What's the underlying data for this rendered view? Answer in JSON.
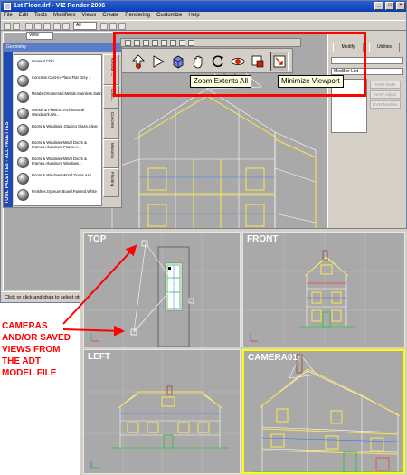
{
  "window": {
    "title": "1st Floor.drf - VIZ Render 2006",
    "controls": [
      "_",
      "□",
      "×"
    ]
  },
  "menu": [
    "File",
    "Edit",
    "Tools",
    "Modifiers",
    "Views",
    "Create",
    "Rendering",
    "Customize",
    "Help"
  ],
  "toolbar": {
    "selection_filter": "All",
    "reference_coord": "View"
  },
  "command_panel": {
    "tabs": [
      "Modify",
      "Utilities"
    ],
    "modifier_list": "Modifier List",
    "buttons": [
      "NVW Make",
      "NVW Adjust",
      "NVW Modifier"
    ]
  },
  "tool_palette": {
    "header": "Geometry",
    "strip_title": "TOOL PALETTES - ALL PALETTES",
    "items": [
      "General.Chip",
      "Concrete.Cast-In-Place.Flat Grey 1",
      "Metals.Ornamental Metals.Stainless.Satin",
      "Woods & Plastics .Architectural Woodwork.Wo...",
      "Doors & Windows .Glazing Glass.Clear",
      "Doors & Windows.Metal Doors & Frames.Aluminum Frame.A...",
      "Doors & Windows.Metal Doors & Frames.Aluminum Windows...",
      "Doors & Windows.Wood Doors.Ash",
      "Finishes.Gypsum Board.Painted.White"
    ],
    "side_tabs": [
      "Kerosin ...",
      "Conc...",
      "Concrete",
      "Masonry",
      "Flooring"
    ]
  },
  "zoom_toolbar": {
    "buttons": [
      "zoom-icon",
      "orbit-arrow-icon",
      "zoom-extents-icon",
      "pan-hand-icon",
      "arc-rotate-icon",
      "field-of-view-icon",
      "zoom-region-icon",
      "minimize-viewport-icon"
    ],
    "tooltip_zoom_extents": "Zoom Extents All",
    "tooltip_minimize": "Minimize Viewport"
  },
  "status_bar": {
    "prompt": "Click or click-and-drag to select objects"
  },
  "viewports": [
    {
      "label": "TOP"
    },
    {
      "label": "FRONT"
    },
    {
      "label": "LEFT"
    },
    {
      "label": "CAMERA01"
    }
  ],
  "annotation": {
    "text_lines": [
      "CAMERAS",
      "AND/OR SAVED",
      "VIEWS FROM",
      "THE ADT",
      "MODEL FILE"
    ]
  },
  "colors": {
    "highlight": "#ff0000",
    "viewport_bg": "#a9a9a9",
    "active_viewport_border": "#ffff00",
    "title_bar": "#0a3fb3"
  }
}
